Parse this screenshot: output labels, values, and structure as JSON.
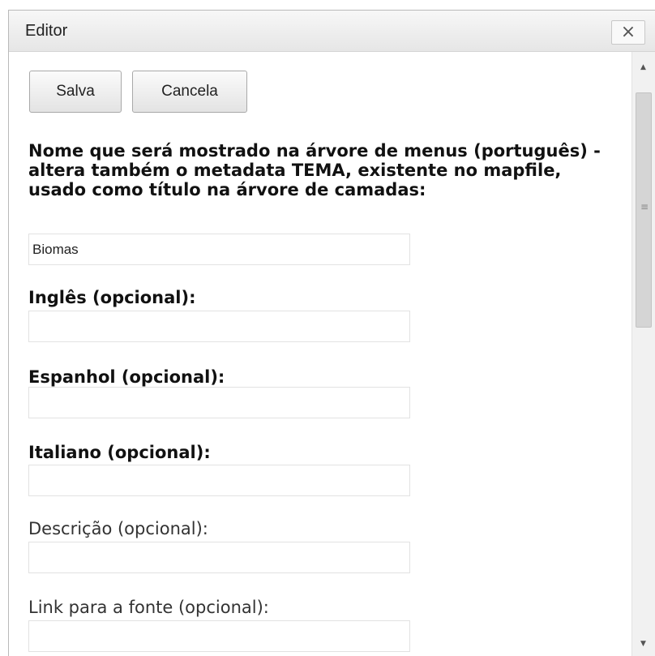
{
  "dialog": {
    "title": "Editor",
    "close_label": "×"
  },
  "toolbar": {
    "save_label": "Salva",
    "cancel_label": "Cancela"
  },
  "fields": [
    {
      "label": "Nome que será mostrado na árvore de menus (português) - altera também o metadata TEMA, existente no mapfile, usado como título na árvore de camadas:",
      "value": "Biomas"
    },
    {
      "label": "Inglês (opcional):",
      "value": ""
    },
    {
      "label": "Espanhol (opcional):",
      "value": ""
    },
    {
      "label": "Italiano (opcional):",
      "value": ""
    },
    {
      "label": "Descrição (opcional):",
      "value": ""
    },
    {
      "label": "Link para a fonte (opcional):",
      "value": ""
    }
  ],
  "scrollbar": {
    "up_arrow": "▲",
    "down_arrow": "▼",
    "grip": "≡"
  }
}
